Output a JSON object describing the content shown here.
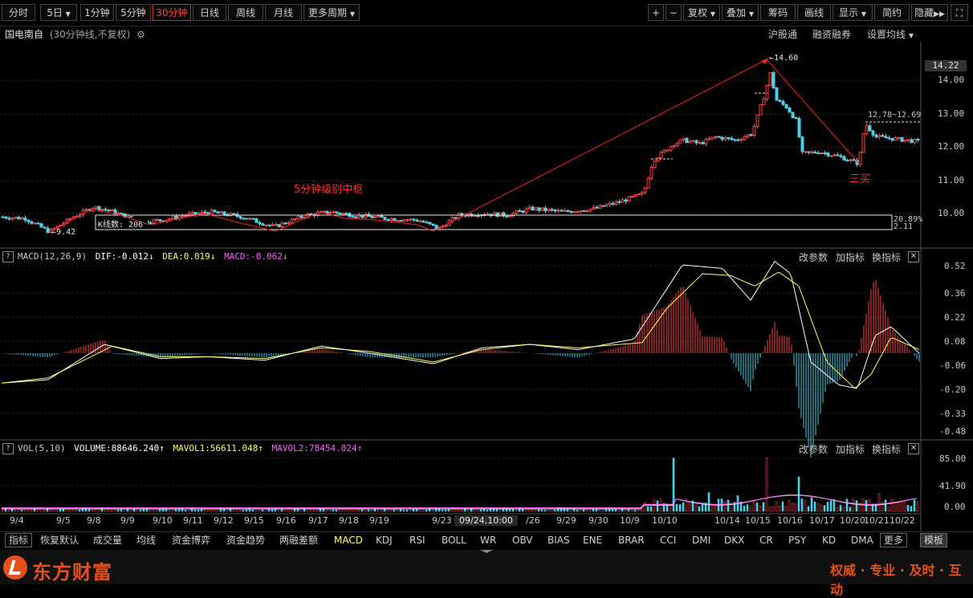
{
  "toolbar": {
    "periods": [
      "分时",
      "5日",
      "1分钟",
      "5分钟",
      "30分钟",
      "日线",
      "周线",
      "月线",
      "更多周期"
    ],
    "active_period": "30分钟",
    "right_buttons": [
      "+",
      "−",
      "复权",
      "叠加",
      "筹码",
      "画线",
      "显示",
      "简约",
      "隐藏"
    ]
  },
  "header": {
    "stock_name": "国电南自",
    "subtitle": "(30分钟线,不复权)",
    "links": [
      "沪股通",
      "融资融券",
      "设置均线"
    ]
  },
  "main_chart": {
    "annotation_zs": "5分钟级别中枢",
    "box_label": "K线数: 206",
    "high_label": "14.60",
    "low_label": "9.42",
    "range_label": "12.78~12.69",
    "buy_label": "三买",
    "right_pct": "20.89%",
    "right_pct2": "2.11",
    "price_axis": [
      "14.00",
      "13.00",
      "12.00",
      "11.00",
      "10.00"
    ],
    "current_price": "14.22"
  },
  "macd": {
    "help": "?",
    "name": "MACD(12,26,9)",
    "dif": "DIF:-0.012",
    "dea": "DEA:0.019",
    "macd_val": "MACD:-0.062",
    "buttons": [
      "改参数",
      "加指标",
      "换指标"
    ],
    "axis": [
      "0.52",
      "0.36",
      "0.22",
      "0.08",
      "-0.06",
      "-0.20",
      "-0.33",
      "-0.48"
    ]
  },
  "volume": {
    "help": "?",
    "name": "VOL(5,10)",
    "volume": "VOLUME:88646.240",
    "mavol1": "MAVOL1:56611.048",
    "mavol2": "MAVOL2:78454.024",
    "buttons": [
      "改参数",
      "加指标",
      "换指标"
    ],
    "axis": [
      "85.00",
      "41.90",
      "0.00"
    ]
  },
  "date_axis": {
    "labels": [
      "9/4",
      "9/5",
      "9/8",
      "9/9",
      "9/10",
      "9/11",
      "9/12",
      "9/15",
      "9/16",
      "9/17",
      "9/18",
      "9/19",
      "9/23",
      "09/24,10:00",
      "/26",
      "9/29",
      "9/30",
      "10/9",
      "10/10",
      "10/14",
      "10/15",
      "10/16",
      "10/17",
      "10/20",
      "10/21",
      "10/22"
    ]
  },
  "tabbar": {
    "tabs": [
      "指标",
      "恢复默认",
      "成交量",
      "均线",
      "资金博弈",
      "资金趋势",
      "两融差额",
      "MACD",
      "KDJ",
      "RSI",
      "BOLL",
      "WR",
      "OBV",
      "BIAS",
      "ENE",
      "BRAR",
      "CCI",
      "DMI",
      "DKX",
      "CR",
      "PSY",
      "KD",
      "DMA",
      "更多",
      "模板"
    ]
  },
  "footer": {
    "brand": "东方财富",
    "slogan": "权威 · 专业 · 及时 · 互动"
  },
  "colors": {
    "up": "#ff4444",
    "down": "#4fd0e8",
    "accent": "#ff3030",
    "dif_line": "#ffffff",
    "dea_line": "#ffff60"
  }
}
